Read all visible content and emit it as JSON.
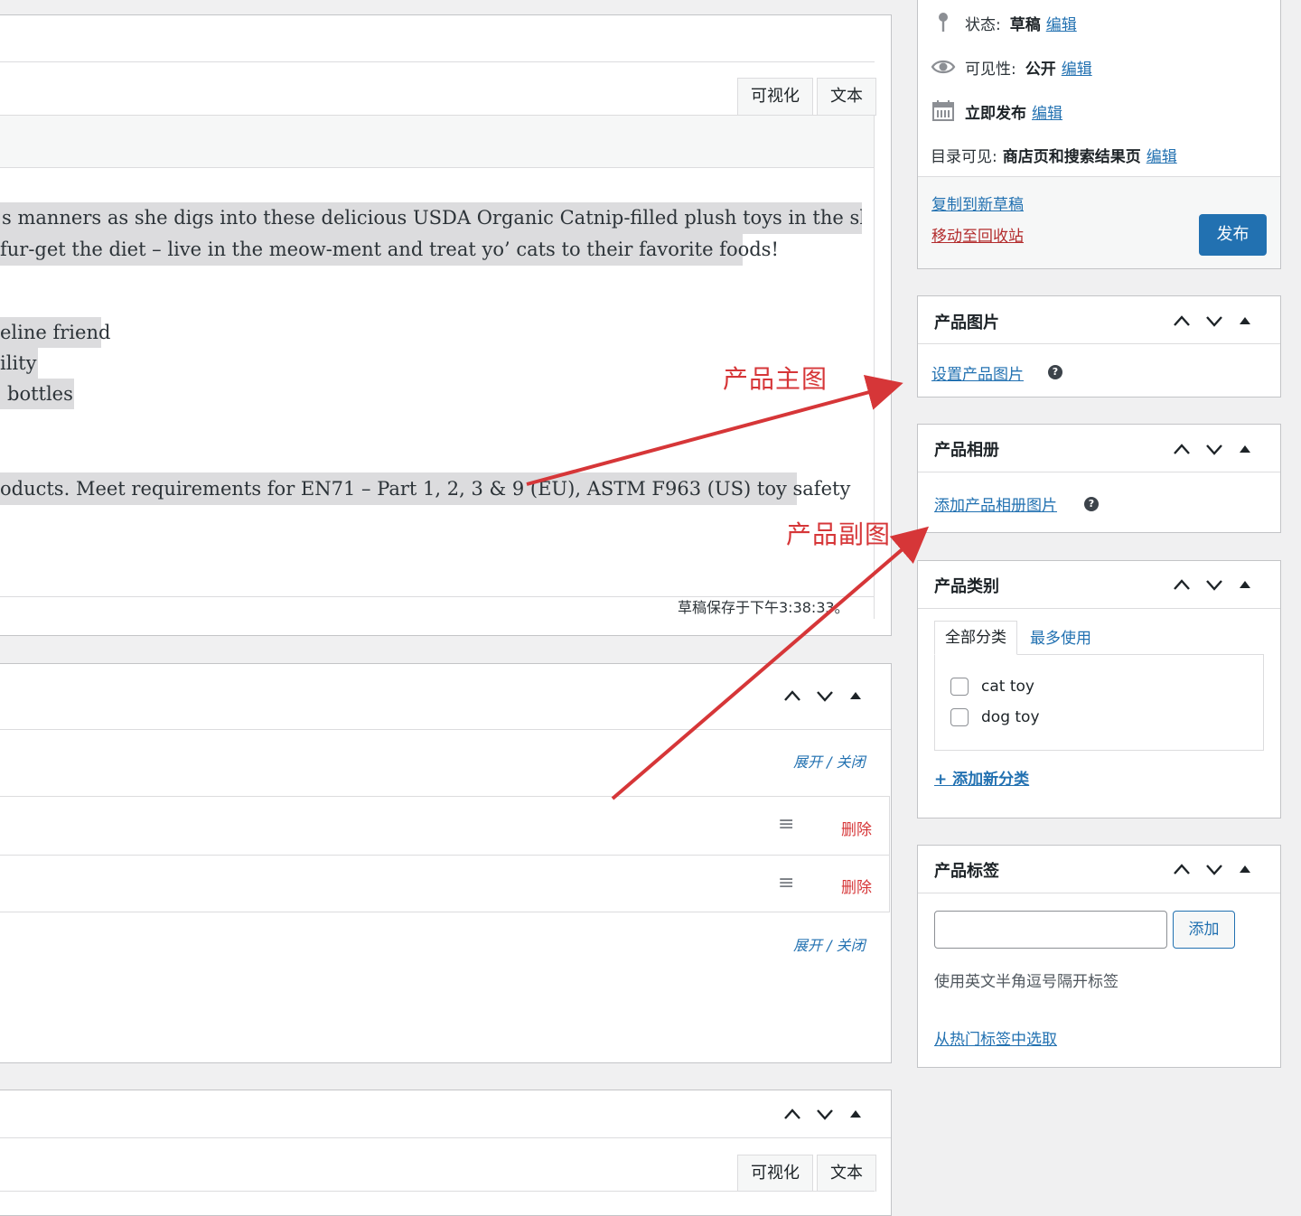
{
  "editor": {
    "tabs": [
      "可视化",
      "文本"
    ],
    "lines": [
      "s manners as she digs into these delicious USDA Organic Catnip-filled plush toys in the shapes",
      "fur-get the diet – live in the meow-ment and treat yo’ cats to their favorite foods!",
      "eline friend",
      "ility",
      "bottles",
      "oducts. Meet requirements for EN71 – Part 1, 2, 3 & 9 (EU), ASTM F963 (US) toy safety"
    ],
    "status": "草稿保存于下午3:38:33。"
  },
  "attributes": {
    "expand_close_top": "展开 / 关闭",
    "rows": [
      {
        "delete": "删除"
      },
      {
        "delete": "删除"
      }
    ],
    "expand_close_bottom": "展开 / 关闭"
  },
  "lower_editor": {
    "tabs": [
      "可视化",
      "文本"
    ]
  },
  "publish": {
    "status_label": "状态:",
    "status_value": "草稿",
    "visibility_label": "可见性:",
    "visibility_value": "公开",
    "publish_label": "立即发布",
    "catalog_label": "目录可见:",
    "catalog_value": "商店页和搜索结果页",
    "edit": "编辑",
    "copy_draft": "复制到新草稿",
    "trash": "移动至回收站",
    "publish_button": "发布"
  },
  "product_image": {
    "title": "产品图片",
    "set_link": "设置产品图片",
    "help": "?"
  },
  "product_gallery": {
    "title": "产品相册",
    "add_link": "添加产品相册图片",
    "help": "?"
  },
  "product_categories": {
    "title": "产品类别",
    "tab_all": "全部分类",
    "tab_most": "最多使用",
    "items": [
      "cat toy",
      "dog toy"
    ],
    "add_new": "+ 添加新分类"
  },
  "product_tags": {
    "title": "产品标签",
    "input_value": "",
    "add_button": "添加",
    "hint": "使用英文半角逗号隔开标签",
    "choose_popular": "从热门标签中选取"
  },
  "annotations": {
    "main_image": "产品主图",
    "gallery_images": "产品副图"
  },
  "colors": {
    "accent": "#2271b1",
    "publish_button": "#2271b1",
    "annotation": "#d63638",
    "trash": "#b32d2e"
  }
}
